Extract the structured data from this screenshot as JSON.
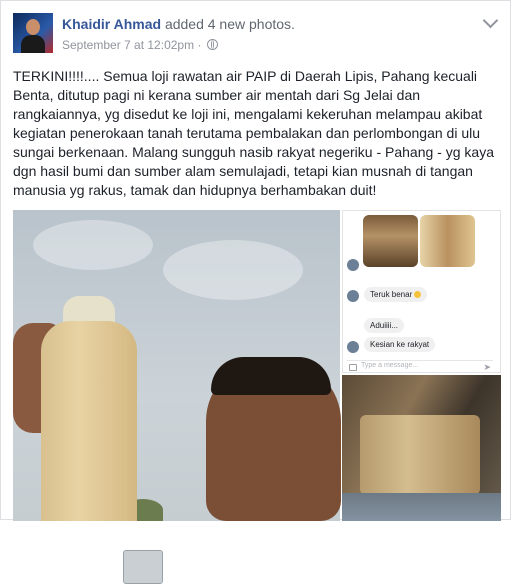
{
  "post": {
    "author": "Khaidir Ahmad",
    "action": "added 4 new photos.",
    "date": "September 7 at 12:02pm",
    "separator": "·",
    "privacy_icon": "globe-icon",
    "menu_icon": "chevron-down-icon",
    "body": "TERKINI!!!!.... Semua loji rawatan air PAIP di Daerah Lipis, Pahang kecuali Benta, ditutup pagi ni kerana sumber air mentah dari Sg Jelai dan rangkaiannya, yg disedut ke loji ini, mengalami kekeruhan melampau akibat kegiatan penerokaan tanah terutama pembalakan dan perlombongan di ulu sungai berkenaan. Malang sungguh nasib rakyat negeriku - Pahang - yg kaya dgn hasil bumi dan sumber alam semulajadi, tetapi kian musnah di tangan manusia yg rakus, tamak dan hidupnya berhambakan duit!"
  },
  "chat": {
    "messages": [
      {
        "text": "Teruk benar"
      },
      {
        "text": "Aduiiii..."
      },
      {
        "text": "Kesian ke rakyat"
      }
    ],
    "input_placeholder": "Type a message..."
  },
  "colors": {
    "author_link": "#365899",
    "meta_gray": "#90949c",
    "text": "#1d2129",
    "border": "#dddfe2"
  }
}
